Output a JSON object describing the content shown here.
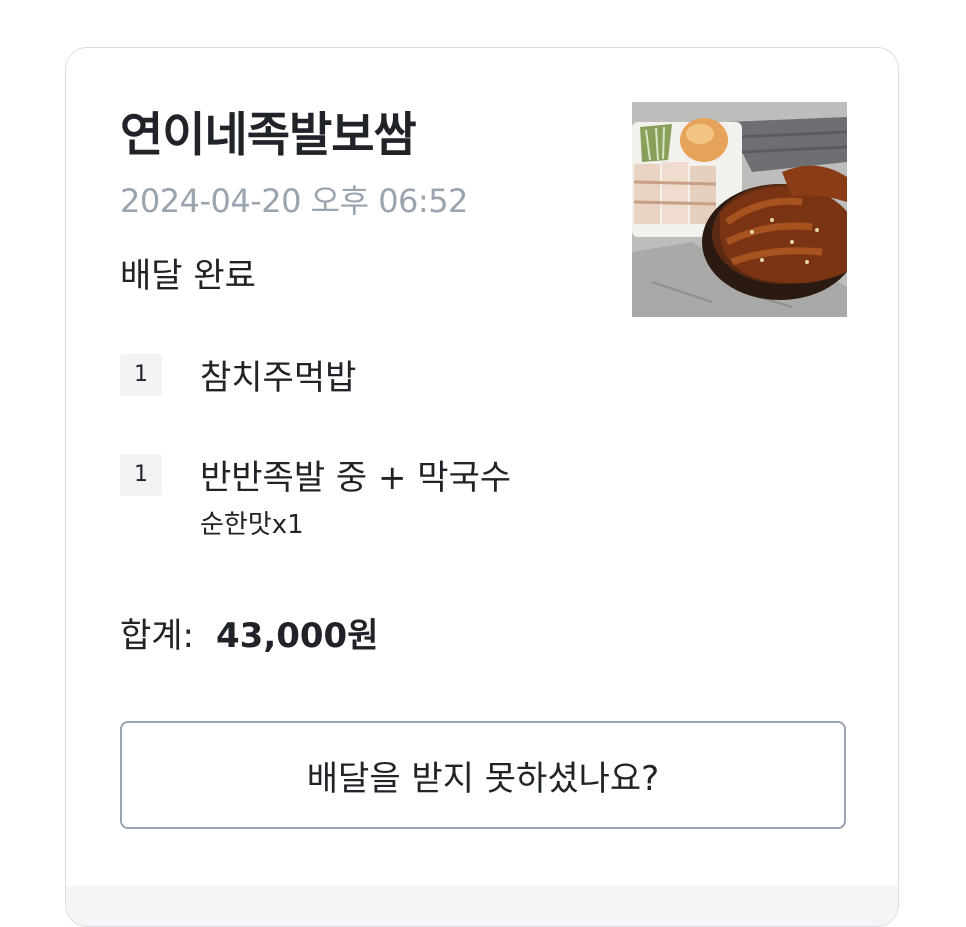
{
  "order": {
    "store_name": "연이네족발보쌈",
    "datetime": "2024-04-20 오후 06:52",
    "status": "배달 완료",
    "items": [
      {
        "qty": "1",
        "name": "참치주먹밥",
        "option": ""
      },
      {
        "qty": "1",
        "name": "반반족발 중 + 막국수",
        "option": "순한맛x1"
      }
    ],
    "total_label": "합계:",
    "total_value": "43,000원",
    "help_button_label": "배달을 받지 못하셨나요?",
    "thumbnail_icon": "food-photo-icon"
  },
  "colors": {
    "card_border": "#d9dde2",
    "time_text": "#9aa4af",
    "qty_badge_bg": "#f1f3f5",
    "button_border": "#9aa4b0",
    "footer_band": "#f4f5f7"
  }
}
